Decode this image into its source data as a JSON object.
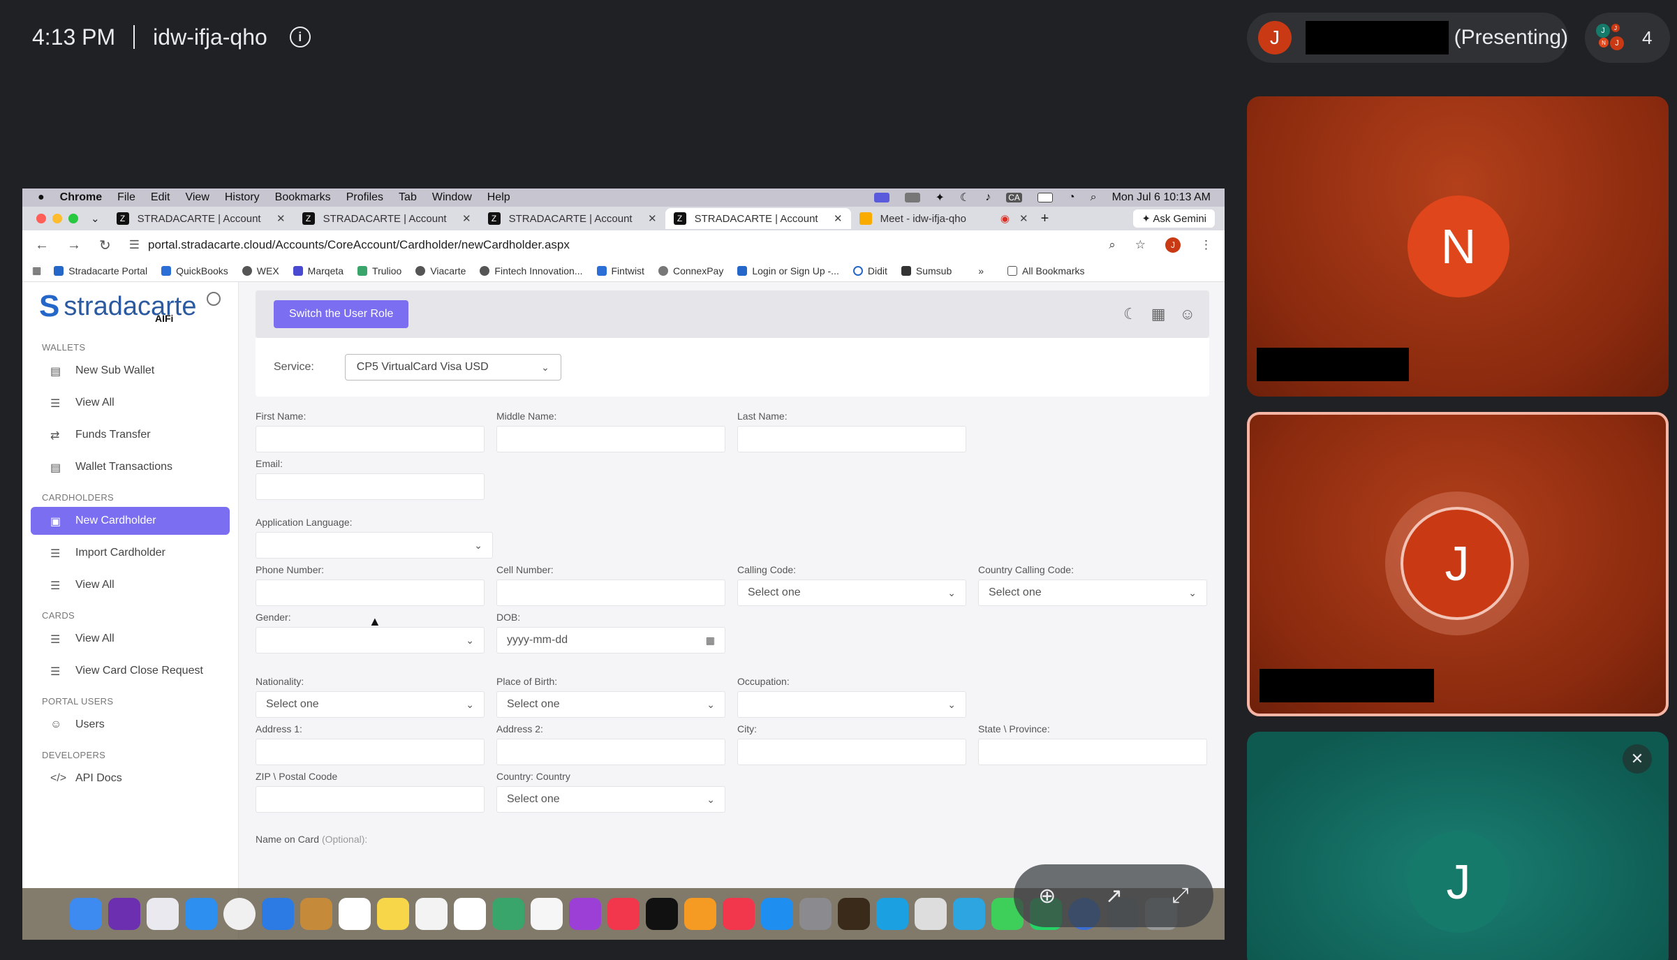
{
  "meet": {
    "time": "4:13 PM",
    "meeting_code": "idw-ifja-qho",
    "presenter_initial": "J",
    "presenting_label": "(Presenting)",
    "participant_count": "4",
    "tiles": [
      {
        "initial": "N"
      },
      {
        "initial": "J"
      },
      {
        "initial": "J"
      }
    ]
  },
  "mac_menu": {
    "app": "Chrome",
    "items": [
      "File",
      "Edit",
      "View",
      "History",
      "Bookmarks",
      "Profiles",
      "Tab",
      "Window",
      "Help"
    ],
    "clock": "Mon Jul 6  10:13 AM",
    "ca_badge": "CA"
  },
  "browser": {
    "tabs": [
      {
        "title": "STRADACARTE | Account"
      },
      {
        "title": "STRADACARTE | Account"
      },
      {
        "title": "STRADACARTE | Account"
      },
      {
        "title": "STRADACARTE | Account"
      },
      {
        "title": "Meet - idw-ifja-qho"
      }
    ],
    "ask_gemini": "Ask Gemini",
    "url": "portal.stradacarte.cloud/Accounts/CoreAccount/Cardholder/newCardholder.aspx",
    "profile_initial": "J",
    "bookmarks": [
      "Stradacarte Portal",
      "QuickBooks",
      "WEX",
      "Marqeta",
      "Trulioo",
      "Viacarte",
      "Fintech Innovation...",
      "Fintwist",
      "ConnexPay",
      "Login or Sign Up -...",
      "Didit",
      "Sumsub"
    ],
    "all_bookmarks": "All Bookmarks"
  },
  "sidebar": {
    "logo_text": "stradacarte",
    "logo_sub": "AIFi",
    "sections": [
      {
        "title": "WALLETS",
        "items": [
          "New Sub Wallet",
          "View All",
          "Funds Transfer",
          "Wallet Transactions"
        ]
      },
      {
        "title": "CARDHOLDERS",
        "items": [
          "New Cardholder",
          "Import Cardholder",
          "View All"
        ]
      },
      {
        "title": "CARDS",
        "items": [
          "View All",
          "View Card Close Request"
        ]
      },
      {
        "title": "PORTAL USERS",
        "items": [
          "Users"
        ]
      },
      {
        "title": "DEVELOPERS",
        "items": [
          "API Docs"
        ]
      }
    ]
  },
  "form": {
    "switch_role": "Switch the User Role",
    "service_label": "Service:",
    "service_value": "CP5 VirtualCard Visa USD",
    "labels": {
      "first_name": "First Name:",
      "middle_name": "Middle Name:",
      "last_name": "Last Name:",
      "email": "Email:",
      "app_language": "Application Language:",
      "phone": "Phone Number:",
      "cell": "Cell Number:",
      "calling_code": "Calling Code:",
      "country_calling_code": "Country Calling Code:",
      "gender": "Gender:",
      "dob": "DOB:",
      "nationality": "Nationality:",
      "place_of_birth": "Place of Birth:",
      "occupation": "Occupation:",
      "address1": "Address 1:",
      "address2": "Address 2:",
      "city": "City:",
      "state": "State \\ Province:",
      "zip": "ZIP \\ Postal Coode",
      "country": "Country: Country",
      "name_on_card": "Name on Card",
      "optional": "(Optional):"
    },
    "select_one": "Select one",
    "dob_placeholder": "yyyy-mm-dd"
  }
}
